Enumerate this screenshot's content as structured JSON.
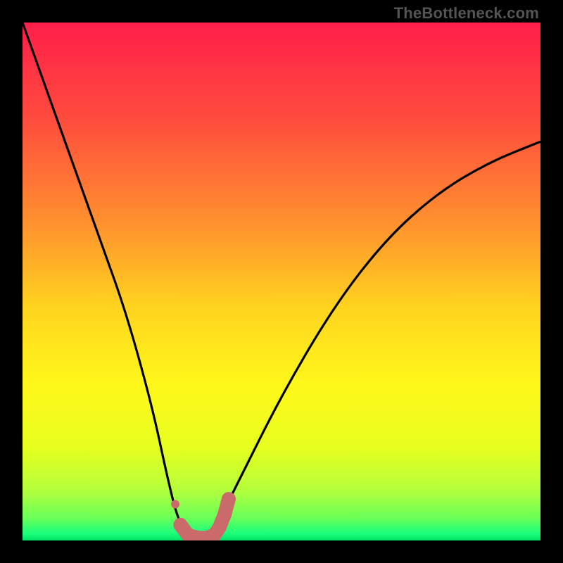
{
  "watermark": "TheBottleneck.com",
  "chart_data": {
    "type": "line",
    "title": "",
    "xlabel": "",
    "ylabel": "",
    "xlim": [
      0,
      100
    ],
    "ylim": [
      0,
      100
    ],
    "grid": false,
    "legend": false,
    "series": [
      {
        "name": "bottleneck-curve",
        "x": [
          0,
          5,
          10,
          15,
          20,
          25,
          28,
          30,
          32,
          34,
          36,
          38,
          42,
          50,
          60,
          70,
          80,
          90,
          100
        ],
        "y": [
          100,
          86,
          72,
          58,
          44,
          26,
          12,
          4,
          1,
          0,
          1,
          4,
          12,
          28,
          45,
          58,
          67,
          73,
          77
        ]
      },
      {
        "name": "marker-dots",
        "x": [
          29.5,
          30.5,
          32,
          34,
          35.5,
          37,
          38,
          39,
          39.8
        ],
        "y": [
          7,
          3,
          1,
          0.5,
          0.5,
          1,
          2.5,
          5,
          8
        ]
      }
    ],
    "gradient_stops": [
      {
        "pos": 0.0,
        "color": "#ff1f4a"
      },
      {
        "pos": 0.18,
        "color": "#ff4a3e"
      },
      {
        "pos": 0.38,
        "color": "#ff8e2f"
      },
      {
        "pos": 0.55,
        "color": "#ffd41f"
      },
      {
        "pos": 0.7,
        "color": "#fff81a"
      },
      {
        "pos": 0.82,
        "color": "#e7ff1f"
      },
      {
        "pos": 0.9,
        "color": "#b6ff3a"
      },
      {
        "pos": 0.955,
        "color": "#6dff58"
      },
      {
        "pos": 0.985,
        "color": "#1fff7a"
      },
      {
        "pos": 1.0,
        "color": "#00e46a"
      }
    ],
    "annotations": []
  }
}
